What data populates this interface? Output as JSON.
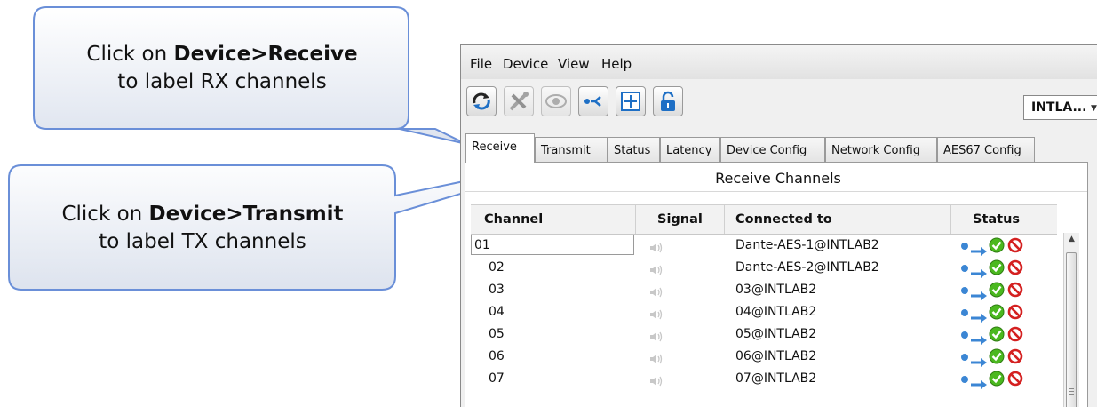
{
  "callouts": [
    {
      "prefix": "Click on ",
      "bold": "Device>Receive",
      "line2": "to label RX channels"
    },
    {
      "prefix": "Click on ",
      "bold": "Device>Transmit",
      "line2": "to label TX channels"
    }
  ],
  "menu": [
    "File",
    "Device",
    "View",
    "Help"
  ],
  "toolbar": {
    "buttons": [
      "refresh-icon",
      "tools-icon",
      "eye-icon",
      "routing-icon",
      "add-icon",
      "unlock-icon"
    ],
    "device_select": "INTLA..."
  },
  "tabs": [
    "Receive",
    "Transmit",
    "Status",
    "Latency",
    "Device Config",
    "Network Config",
    "AES67 Config"
  ],
  "active_tab": "Receive",
  "panel_title": "Receive Channels",
  "columns": {
    "channel": "Channel",
    "signal": "Signal",
    "connected": "Connected to",
    "status": "Status"
  },
  "rows": [
    {
      "channel": "01",
      "connected": "Dante-AES-1@INTLAB2"
    },
    {
      "channel": "02",
      "connected": "Dante-AES-2@INTLAB2"
    },
    {
      "channel": "03",
      "connected": "03@INTLAB2"
    },
    {
      "channel": "04",
      "connected": "04@INTLAB2"
    },
    {
      "channel": "05",
      "connected": "05@INTLAB2"
    },
    {
      "channel": "06",
      "connected": "06@INTLAB2"
    },
    {
      "channel": "07",
      "connected": "07@INTLAB2"
    }
  ],
  "colors": {
    "accent_blue": "#3b86d4",
    "ok_green": "#4bb81f",
    "stop_red": "#d42020",
    "callout_border": "#6a8fd8"
  }
}
